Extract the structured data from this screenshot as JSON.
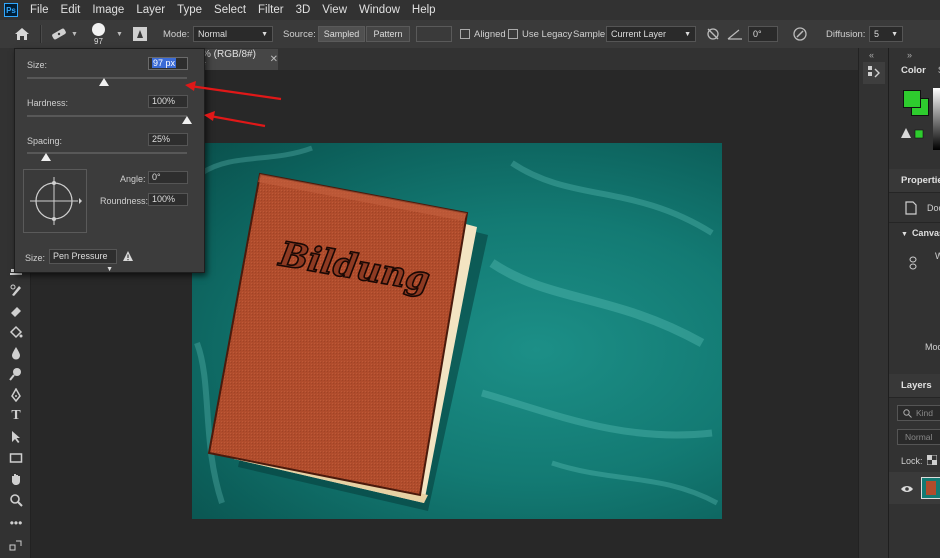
{
  "menu": [
    "File",
    "Edit",
    "Image",
    "Layer",
    "Type",
    "Select",
    "Filter",
    "3D",
    "View",
    "Window",
    "Help"
  ],
  "app_logo": "Ps",
  "options": {
    "brush_size": "97",
    "mode_label": "Mode:",
    "mode_value": "Normal",
    "source_label": "Source:",
    "source_sampled": "Sampled",
    "source_pattern": "Pattern",
    "aligned": "Aligned",
    "use_legacy": "Use Legacy",
    "sample_label": "Sample:",
    "sample_value": "Current Layer",
    "angle_value": "0°",
    "diffusion_label": "Diffusion:",
    "diffusion_value": "5"
  },
  "doc_tab": "% (RGB/8#) *",
  "brush_panel": {
    "size_label": "Size:",
    "size_value": "97 px",
    "hardness_label": "Hardness:",
    "hardness_value": "100%",
    "spacing_label": "Spacing:",
    "spacing_value": "25%",
    "angle_label": "Angle:",
    "angle_value": "0°",
    "roundness_label": "Roundness:",
    "roundness_value": "100%",
    "size_control_label": "Size:",
    "size_control_value": "Pen Pressure",
    "size_level": 0.48,
    "hardness_level": 1.0,
    "spacing_level": 0.12
  },
  "canvas": {
    "book_title": "Bildung",
    "background_color": "#137a73",
    "book_color": "#b04c2c"
  },
  "right_panel": {
    "color_tab": "Color",
    "color_tab2": "S",
    "properties_tab": "Properties",
    "properties_item": "Doc",
    "canvas_section": "Canvas",
    "canvas_side_text": "W",
    "mode_text": "Mod",
    "layers_tab": "Layers",
    "kind_placeholder": "Kind",
    "blend_mode": "Normal",
    "lock_label": "Lock:",
    "foreground_color": "#2ecc2e",
    "background_swatch_color": "#2ecc2e"
  }
}
